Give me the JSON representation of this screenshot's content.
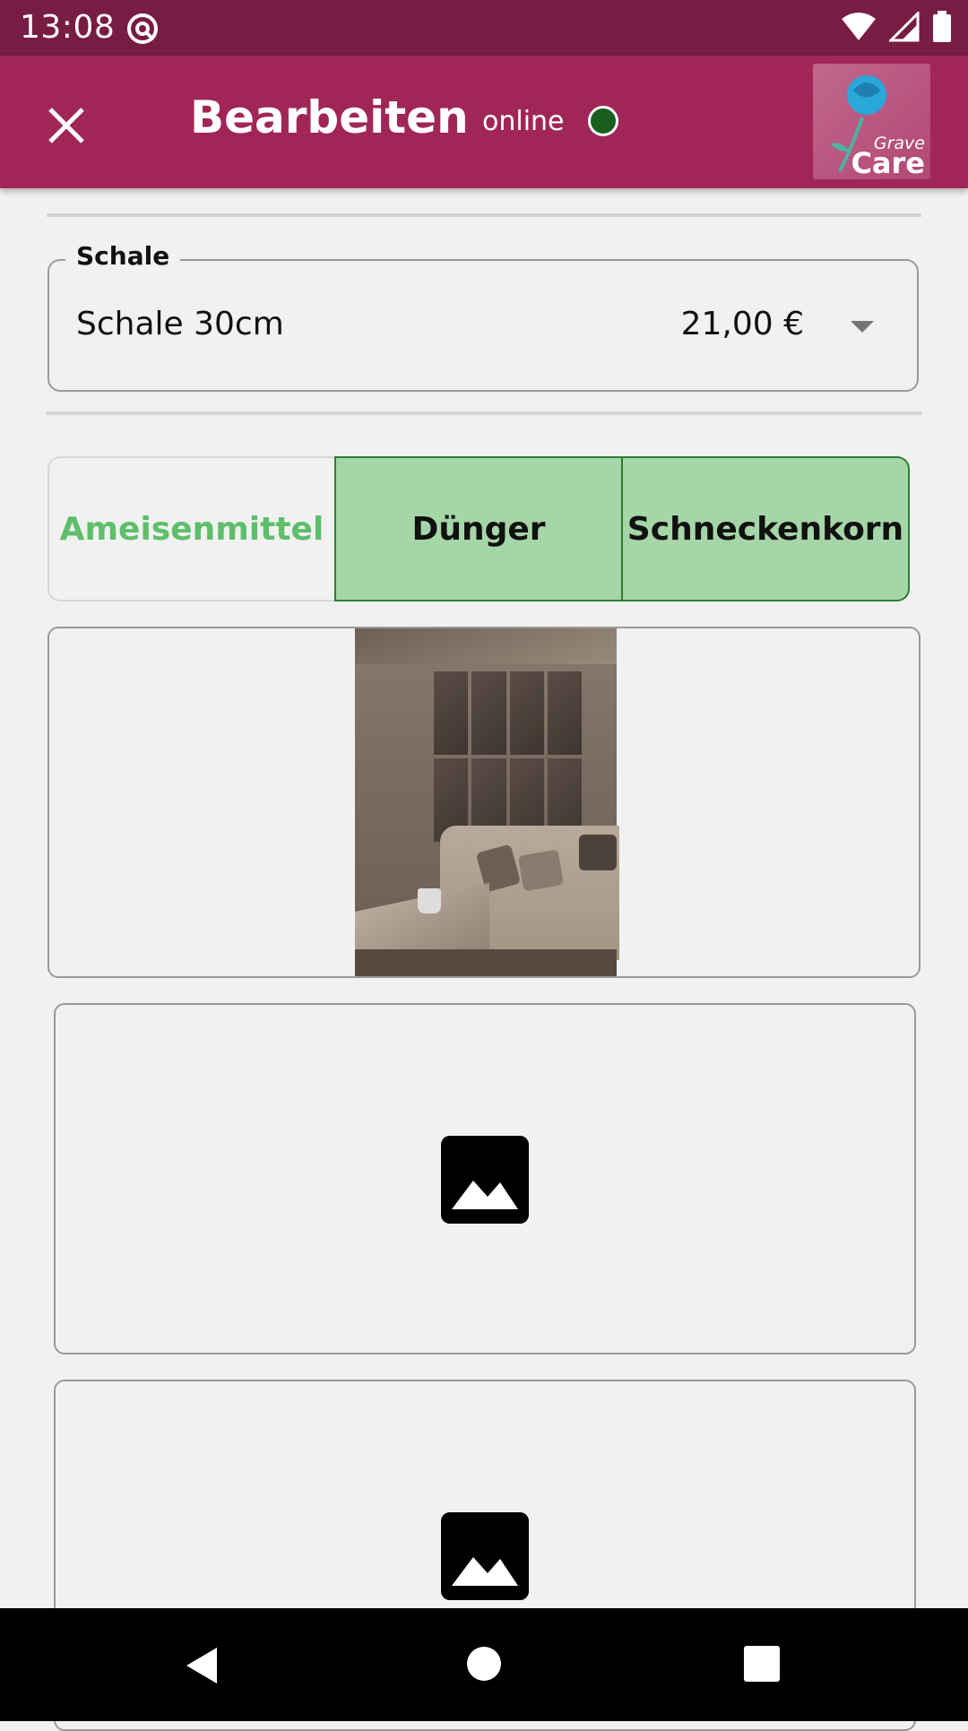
{
  "status_bar": {
    "time": "13:08",
    "icons": [
      "at-sign-icon",
      "wifi-icon",
      "signal-icon",
      "battery-icon"
    ]
  },
  "app_bar": {
    "title": "Bearbeiten",
    "connection_status": "online",
    "connection_color": "#1a5e1f",
    "logo_line1": "Grave",
    "logo_line2": "Care",
    "background": "#a12658"
  },
  "schale_field": {
    "label": "Schale",
    "value": "Schale 30cm",
    "price": "21,00 €"
  },
  "toggle_group": {
    "options": [
      {
        "label": "Ameisenmittel",
        "selected": false
      },
      {
        "label": "Dünger",
        "selected": true
      },
      {
        "label": "Schneckenkorn",
        "selected": true
      }
    ],
    "selected_color": "#a5d6a7"
  },
  "images": [
    {
      "type": "photo",
      "icon": "photo-icon"
    },
    {
      "type": "placeholder",
      "icon": "image-placeholder-icon"
    },
    {
      "type": "placeholder",
      "icon": "image-placeholder-icon"
    }
  ],
  "nav_bar": {
    "icons": [
      "back-icon",
      "home-icon",
      "recents-icon"
    ]
  }
}
